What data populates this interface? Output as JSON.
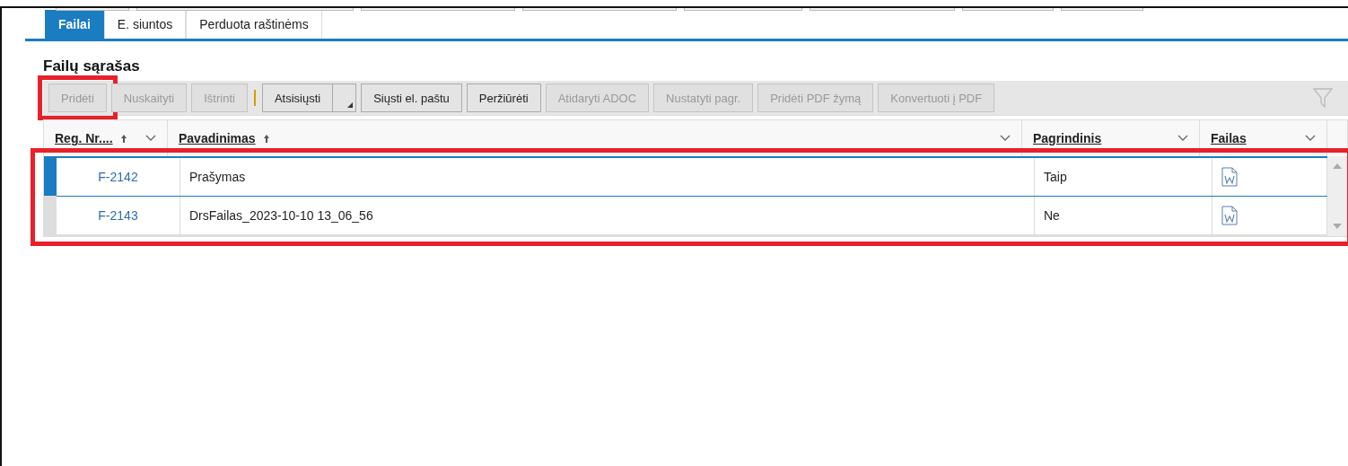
{
  "tabs": [
    {
      "label": "Failai",
      "selected": true
    },
    {
      "label": "E. siuntos",
      "selected": false
    },
    {
      "label": "Perduota raštinėms",
      "selected": false
    }
  ],
  "section_title": "Failų sąrašas",
  "toolbar": [
    {
      "kind": "button",
      "label": "Pridėti",
      "disabled": true,
      "highlighted": true
    },
    {
      "kind": "button",
      "label": "Nuskaityti",
      "disabled": true,
      "highlighted": false
    },
    {
      "kind": "button",
      "label": "Ištrinti",
      "disabled": true,
      "highlighted": false
    },
    {
      "kind": "split",
      "label": "Atsisiųsti",
      "disabled": false,
      "highlighted": false
    },
    {
      "kind": "button",
      "label": "Siųsti el. paštu",
      "disabled": false,
      "highlighted": false
    },
    {
      "kind": "button",
      "label": "Peržiūrėti",
      "disabled": false,
      "highlighted": false
    },
    {
      "kind": "button",
      "label": "Atidaryti ADOC",
      "disabled": true,
      "highlighted": false
    },
    {
      "kind": "button",
      "label": "Nustatyti pagr.",
      "disabled": true,
      "highlighted": false
    },
    {
      "kind": "button",
      "label": "Pridėti PDF žymą",
      "disabled": true,
      "highlighted": false
    },
    {
      "kind": "button",
      "label": "Konvertuoti į PDF",
      "disabled": true,
      "highlighted": false
    }
  ],
  "table": {
    "columns": [
      {
        "label": "Reg. Nr....",
        "sorted": true
      },
      {
        "label": "Pavadinimas",
        "sorted": true
      },
      {
        "label": "Pagrindinis",
        "sorted": false
      },
      {
        "label": "Failas",
        "sorted": false
      }
    ],
    "rows_highlighted": true,
    "rows": [
      {
        "reg_nr": "F-2142",
        "name": "Prašymas",
        "main": "Taip",
        "selected": true
      },
      {
        "reg_nr": "F-2143",
        "name": "DrsFailas_2023-10-10 13_06_56",
        "main": "Ne",
        "selected": false
      }
    ]
  }
}
